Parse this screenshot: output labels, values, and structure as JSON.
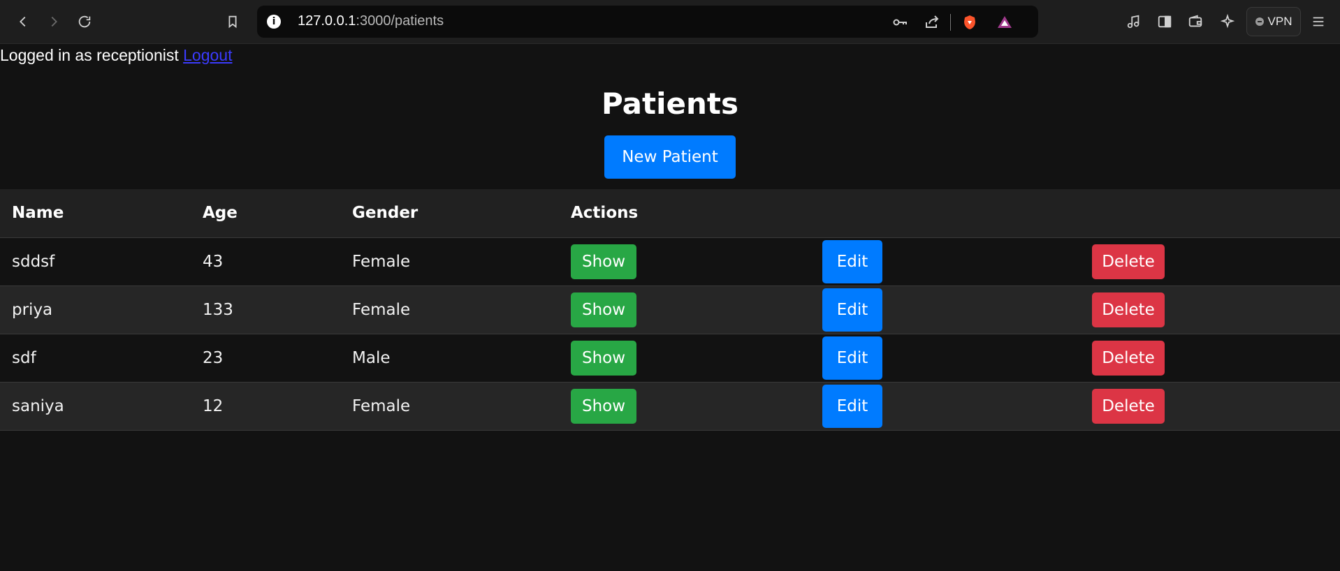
{
  "browser": {
    "url_host": "127.0.0.1",
    "url_path": ":3000/patients",
    "vpn_label": "VPN"
  },
  "page": {
    "login_text": "Logged in as receptionist ",
    "logout_label": "Logout",
    "title": "Patients",
    "new_button_label": "New Patient"
  },
  "table": {
    "headers": {
      "name": "Name",
      "age": "Age",
      "gender": "Gender",
      "actions": "Actions"
    },
    "rows": [
      {
        "name": "sddsf",
        "age": "43",
        "gender": "Female",
        "show": "Show",
        "edit": "Edit",
        "delete": "Delete"
      },
      {
        "name": "priya",
        "age": "133",
        "gender": "Female",
        "show": "Show",
        "edit": "Edit",
        "delete": "Delete"
      },
      {
        "name": "sdf",
        "age": "23",
        "gender": "Male",
        "show": "Show",
        "edit": "Edit",
        "delete": "Delete"
      },
      {
        "name": "saniya",
        "age": "12",
        "gender": "Female",
        "show": "Show",
        "edit": "Edit",
        "delete": "Delete"
      }
    ]
  },
  "colors": {
    "background": "#121212",
    "primary": "#007bff",
    "success": "#28a745",
    "danger": "#dc3545"
  }
}
